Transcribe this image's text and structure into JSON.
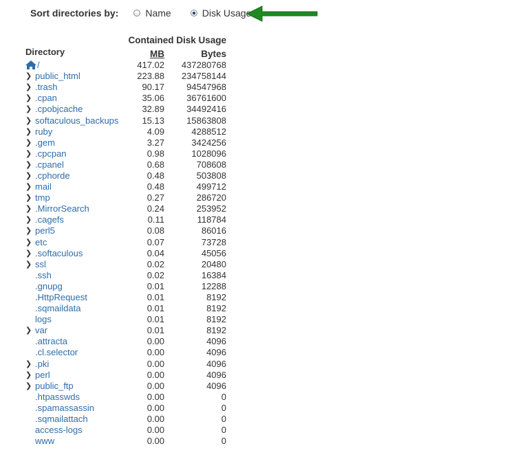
{
  "sort": {
    "label": "Sort directories by:",
    "options": [
      {
        "label": "Name",
        "checked": false
      },
      {
        "label": "Disk Usage",
        "checked": true
      }
    ]
  },
  "colors": {
    "link": "#2d6dab",
    "arrow": "#1f8a1f",
    "text": "#333333"
  },
  "table": {
    "directory_header": "Directory",
    "usage_header": "Contained Disk Usage",
    "mb_header": "MB",
    "bytes_header": "Bytes",
    "home": {
      "name": "/",
      "mb": "417.02",
      "bytes": "437280768",
      "icon": "home-icon"
    },
    "rows": [
      {
        "name": "public_html",
        "mb": "223.88",
        "bytes": "234758144",
        "expandable": true
      },
      {
        "name": ".trash",
        "mb": "90.17",
        "bytes": "94547968",
        "expandable": true
      },
      {
        "name": ".cpan",
        "mb": "35.06",
        "bytes": "36761600",
        "expandable": true
      },
      {
        "name": ".cpobjcache",
        "mb": "32.89",
        "bytes": "34492416",
        "expandable": true
      },
      {
        "name": "softaculous_backups",
        "mb": "15.13",
        "bytes": "15863808",
        "expandable": true
      },
      {
        "name": "ruby",
        "mb": "4.09",
        "bytes": "4288512",
        "expandable": true
      },
      {
        "name": ".gem",
        "mb": "3.27",
        "bytes": "3424256",
        "expandable": true
      },
      {
        "name": ".cpcpan",
        "mb": "0.98",
        "bytes": "1028096",
        "expandable": true
      },
      {
        "name": ".cpanel",
        "mb": "0.68",
        "bytes": "708608",
        "expandable": true
      },
      {
        "name": ".cphorde",
        "mb": "0.48",
        "bytes": "503808",
        "expandable": true
      },
      {
        "name": "mail",
        "mb": "0.48",
        "bytes": "499712",
        "expandable": true
      },
      {
        "name": "tmp",
        "mb": "0.27",
        "bytes": "286720",
        "expandable": true
      },
      {
        "name": ".MirrorSearch",
        "mb": "0.24",
        "bytes": "253952",
        "expandable": true
      },
      {
        "name": ".cagefs",
        "mb": "0.11",
        "bytes": "118784",
        "expandable": true
      },
      {
        "name": "perl5",
        "mb": "0.08",
        "bytes": "86016",
        "expandable": true
      },
      {
        "name": "etc",
        "mb": "0.07",
        "bytes": "73728",
        "expandable": true
      },
      {
        "name": ".softaculous",
        "mb": "0.04",
        "bytes": "45056",
        "expandable": true
      },
      {
        "name": "ssl",
        "mb": "0.02",
        "bytes": "20480",
        "expandable": true
      },
      {
        "name": ".ssh",
        "mb": "0.02",
        "bytes": "16384",
        "expandable": false
      },
      {
        "name": ".gnupg",
        "mb": "0.01",
        "bytes": "12288",
        "expandable": false
      },
      {
        "name": ".HttpRequest",
        "mb": "0.01",
        "bytes": "8192",
        "expandable": false
      },
      {
        "name": ".sqmaildata",
        "mb": "0.01",
        "bytes": "8192",
        "expandable": false
      },
      {
        "name": "logs",
        "mb": "0.01",
        "bytes": "8192",
        "expandable": false
      },
      {
        "name": "var",
        "mb": "0.01",
        "bytes": "8192",
        "expandable": true
      },
      {
        "name": ".attracta",
        "mb": "0.00",
        "bytes": "4096",
        "expandable": false
      },
      {
        "name": ".cl.selector",
        "mb": "0.00",
        "bytes": "4096",
        "expandable": false
      },
      {
        "name": ".pki",
        "mb": "0.00",
        "bytes": "4096",
        "expandable": true
      },
      {
        "name": "perl",
        "mb": "0.00",
        "bytes": "4096",
        "expandable": true
      },
      {
        "name": "public_ftp",
        "mb": "0.00",
        "bytes": "4096",
        "expandable": true
      },
      {
        "name": ".htpasswds",
        "mb": "0.00",
        "bytes": "0",
        "expandable": false
      },
      {
        "name": ".spamassassin",
        "mb": "0.00",
        "bytes": "0",
        "expandable": false
      },
      {
        "name": ".sqmailattach",
        "mb": "0.00",
        "bytes": "0",
        "expandable": false
      },
      {
        "name": "access-logs",
        "mb": "0.00",
        "bytes": "0",
        "expandable": false
      },
      {
        "name": "www",
        "mb": "0.00",
        "bytes": "0",
        "expandable": false
      }
    ]
  }
}
